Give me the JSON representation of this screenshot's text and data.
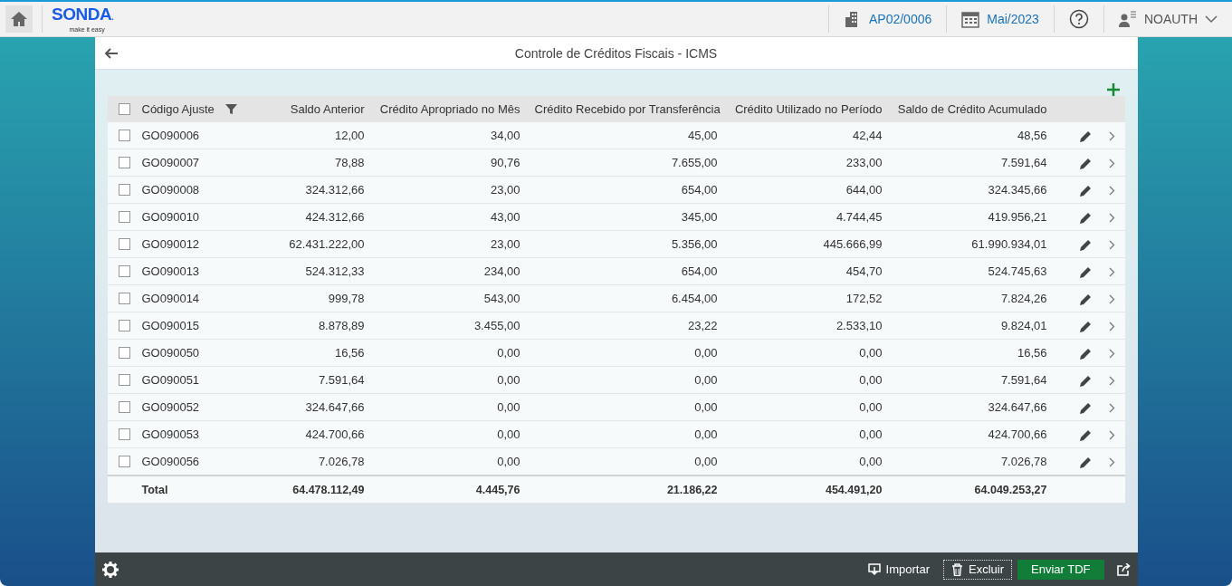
{
  "header": {
    "logo": "SONDA",
    "logo_dot": ".",
    "tagline": "make it easy",
    "company": "AP02/0006",
    "period": "Mai/2023",
    "user": "NOAUTH"
  },
  "page": {
    "title": "Controle de Créditos Fiscais - ICMS"
  },
  "table": {
    "all_checked": false,
    "columns": [
      "Código Ajuste",
      "Saldo Anterior",
      "Crédito Apropriado no Mês",
      "Crédito Recebido por Transferência",
      "Crédito Utilizado no Período",
      "Saldo de Crédito Acumulado"
    ],
    "rows": [
      {
        "checked": false,
        "cells": [
          "GO090006",
          "12,00",
          "34,00",
          "45,00",
          "42,44",
          "48,56"
        ]
      },
      {
        "checked": false,
        "cells": [
          "GO090007",
          "78,88",
          "90,76",
          "7.655,00",
          "233,00",
          "7.591,64"
        ]
      },
      {
        "checked": false,
        "cells": [
          "GO090008",
          "324.312,66",
          "23,00",
          "654,00",
          "644,00",
          "324.345,66"
        ]
      },
      {
        "checked": false,
        "cells": [
          "GO090010",
          "424.312,66",
          "43,00",
          "345,00",
          "4.744,45",
          "419.956,21"
        ]
      },
      {
        "checked": false,
        "cells": [
          "GO090012",
          "62.431.222,00",
          "23,00",
          "5.356,00",
          "445.666,99",
          "61.990.934,01"
        ]
      },
      {
        "checked": false,
        "cells": [
          "GO090013",
          "524.312,33",
          "234,00",
          "654,00",
          "454,70",
          "524.745,63"
        ]
      },
      {
        "checked": false,
        "cells": [
          "GO090014",
          "999,78",
          "543,00",
          "6.454,00",
          "172,52",
          "7.824,26"
        ]
      },
      {
        "checked": false,
        "cells": [
          "GO090015",
          "8.878,89",
          "3.455,00",
          "23,22",
          "2.533,10",
          "9.824,01"
        ]
      },
      {
        "checked": false,
        "cells": [
          "GO090050",
          "16,56",
          "0,00",
          "0,00",
          "0,00",
          "16,56"
        ]
      },
      {
        "checked": false,
        "cells": [
          "GO090051",
          "7.591,64",
          "0,00",
          "0,00",
          "0,00",
          "7.591,64"
        ]
      },
      {
        "checked": false,
        "cells": [
          "GO090052",
          "324.647,66",
          "0,00",
          "0,00",
          "0,00",
          "324.647,66"
        ]
      },
      {
        "checked": false,
        "cells": [
          "GO090053",
          "424.700,66",
          "0,00",
          "0,00",
          "0,00",
          "424.700,66"
        ]
      },
      {
        "checked": false,
        "cells": [
          "GO090056",
          "7.026,78",
          "0,00",
          "0,00",
          "0,00",
          "7.026,78"
        ]
      }
    ],
    "total": [
      "Total",
      "64.478.112,49",
      "4.445,76",
      "21.186,22",
      "454.491,20",
      "64.049.253,27"
    ]
  },
  "footer": {
    "buttons": [
      {
        "kind": "import",
        "label": "Importar"
      },
      {
        "kind": "delete",
        "label": "Excluir"
      },
      {
        "kind": "primary",
        "label": "Enviar TDF"
      }
    ]
  }
}
